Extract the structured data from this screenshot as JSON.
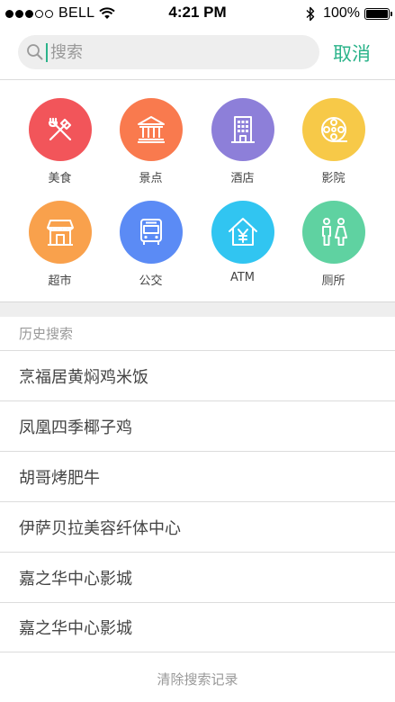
{
  "status_bar": {
    "carrier": "BELL",
    "time": "4:21 PM",
    "battery": "100%",
    "battery_level": 1.0
  },
  "search": {
    "placeholder": "搜索",
    "value": "",
    "cancel_label": "取消"
  },
  "categories": [
    {
      "label": "美食",
      "icon": "food-icon",
      "color": "#f2555a"
    },
    {
      "label": "景点",
      "icon": "landmark-icon",
      "color": "#f97a4e"
    },
    {
      "label": "酒店",
      "icon": "hotel-icon",
      "color": "#8d7fd9"
    },
    {
      "label": "影院",
      "icon": "film-reel-icon",
      "color": "#f7c948"
    },
    {
      "label": "超市",
      "icon": "store-icon",
      "color": "#f9a14c"
    },
    {
      "label": "公交",
      "icon": "bus-icon",
      "color": "#5b8bf5"
    },
    {
      "label": "ATM",
      "icon": "atm-icon",
      "color": "#31c5f1"
    },
    {
      "label": "厕所",
      "icon": "restroom-icon",
      "color": "#5fd2a1"
    }
  ],
  "history": {
    "title": "历史搜索",
    "items": [
      "烹福居黄焖鸡米饭",
      "凤凰四季椰子鸡",
      "胡哥烤肥牛",
      "伊萨贝拉美容纤体中心",
      "嘉之华中心影城",
      "嘉之华中心影城"
    ],
    "clear_label": "清除搜索记录"
  },
  "colors": {
    "accent": "#2bb38a",
    "search_bg": "#eeeeee",
    "divider": "#dcdcdc"
  }
}
